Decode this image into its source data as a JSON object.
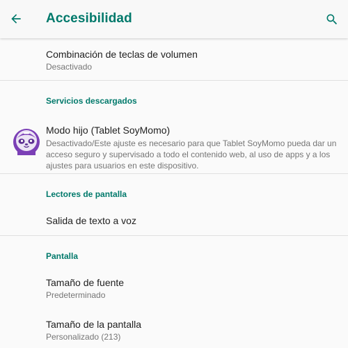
{
  "header": {
    "title": "Accesibilidad",
    "back_icon": "arrow-back-icon",
    "search_icon": "search-icon",
    "accent_color": "#00796b"
  },
  "items": {
    "volume_keys": {
      "title": "Combinación de teclas de volumen",
      "subtitle": "Desactivado"
    },
    "kid_mode": {
      "title": "Modo hijo (Tablet SoyMomo)",
      "description": "Desactivado/Este ajuste es necesario para que Tablet SoyMomo pueda dar un acceso seguro y supervisado a todo el contenido web, al uso de apps y a los ajustes para usuarios en este dispositivo.",
      "icon": "soymomo-app-icon"
    },
    "tts": {
      "title": "Salida de texto a voz"
    },
    "font_size": {
      "title": "Tamaño de fuente",
      "subtitle": "Predeterminado"
    },
    "display_size": {
      "title": "Tamaño de la pantalla",
      "subtitle": "Personalizado (213)"
    }
  },
  "sections": {
    "downloaded": "Servicios descargados",
    "screen_readers": "Lectores de pantalla",
    "display": "Pantalla"
  }
}
